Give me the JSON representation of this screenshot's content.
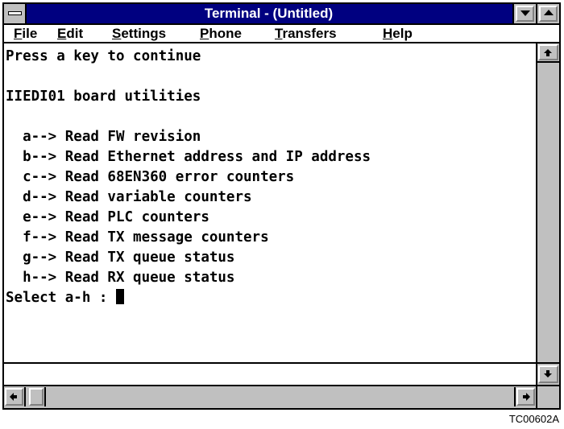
{
  "window": {
    "title": "Terminal - (Untitled)"
  },
  "menubar": {
    "items": [
      {
        "key": "F",
        "rest": "ile"
      },
      {
        "key": "E",
        "rest": "dit"
      },
      {
        "key": "S",
        "rest": "ettings"
      },
      {
        "key": "P",
        "rest": "hone"
      },
      {
        "key": "T",
        "rest": "ransfers"
      },
      {
        "key": "H",
        "rest": "elp"
      }
    ]
  },
  "terminal": {
    "lines": [
      "Press a key to continue",
      "",
      "IIEDI01 board utilities",
      "",
      "  a--> Read FW revision",
      "  b--> Read Ethernet address and IP address",
      "  c--> Read 68EN360 error counters",
      "  d--> Read variable counters",
      "  e--> Read PLC counters",
      "  f--> Read TX message counters",
      "  g--> Read TX queue status",
      "  h--> Read RX queue status"
    ],
    "prompt": "Select a-h : "
  },
  "figure_id": "TC00602A"
}
